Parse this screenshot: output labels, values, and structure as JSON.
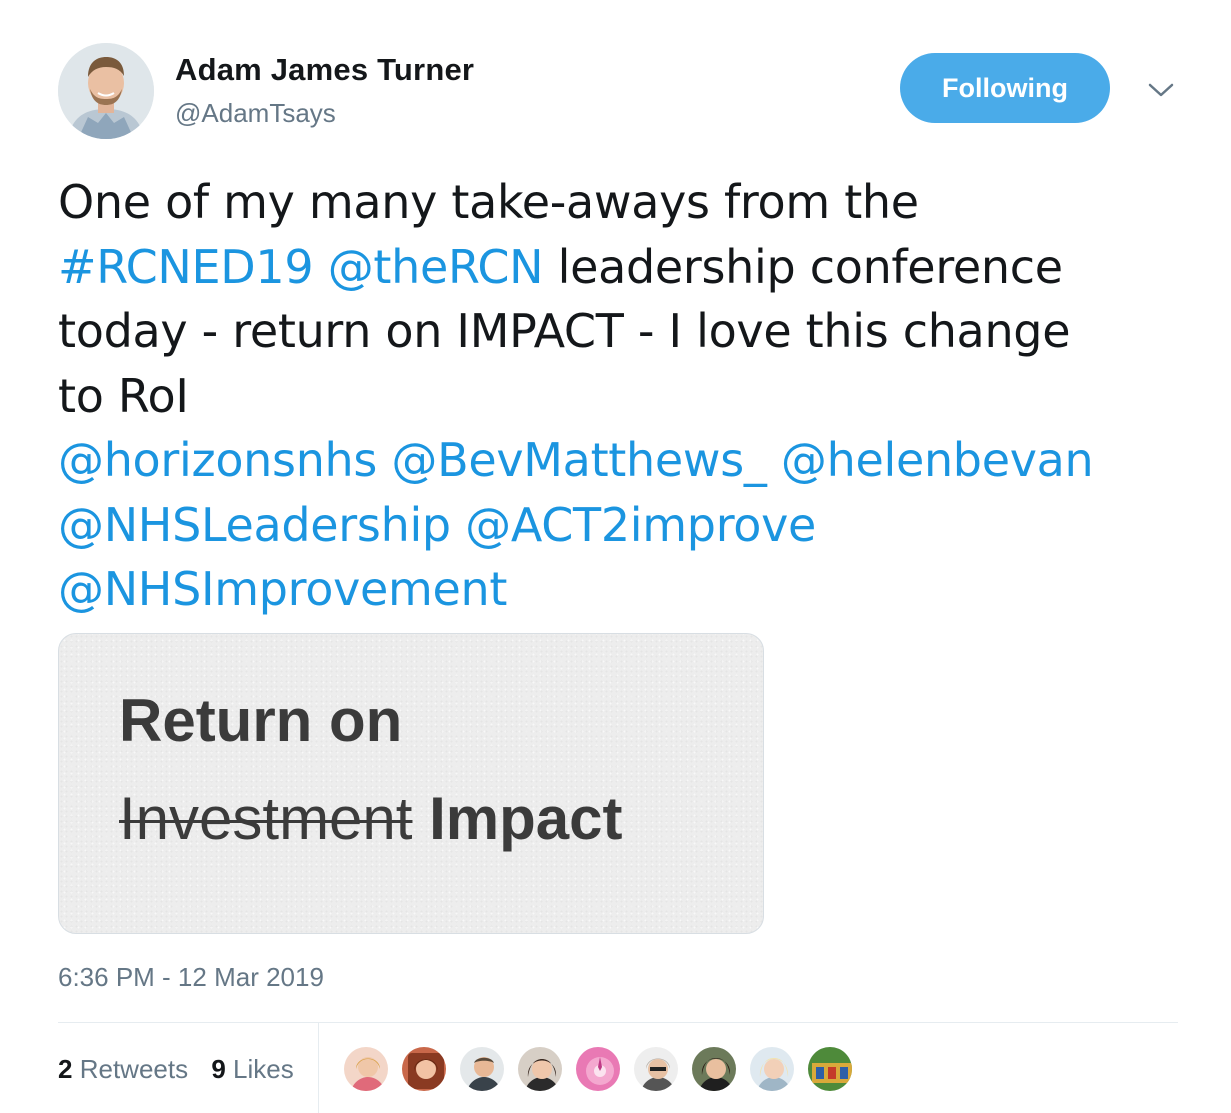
{
  "author": {
    "display_name": "Adam James Turner",
    "handle": "@AdamTsays",
    "avatar_icon": "profile-photo"
  },
  "follow_button": {
    "label": "Following",
    "color": "#4aabe9"
  },
  "menu": {
    "icon": "chevron-down-icon"
  },
  "tweet": {
    "line1": "One of my many take-aways from the",
    "hashtag": "#RCNED19",
    "mention_rcn": "@theRCN",
    "line2_rest": "leadership conference",
    "line3": "today - return on IMPACT - I love this change",
    "line4": "to RoI",
    "mentions": {
      "horizonsnhs": "@horizonsnhs",
      "bevmatthews": "@BevMatthews_",
      "helenbevan": "@helenbevan",
      "nhsleadership": "@NHSLeadership",
      "act2improve": "@ACT2improve",
      "nhsimprovement": "@NHSImprovement"
    },
    "link_color": "#1b95e0"
  },
  "media": {
    "line1": "Return on",
    "struck_word": "Investment",
    "replacement_word": "Impact"
  },
  "timestamp": "6:36 PM - 12 Mar 2019",
  "stats": {
    "retweets_count": "2",
    "retweets_label": "Retweets",
    "likes_count": "9",
    "likes_label": "Likes"
  },
  "likers_count": 9
}
